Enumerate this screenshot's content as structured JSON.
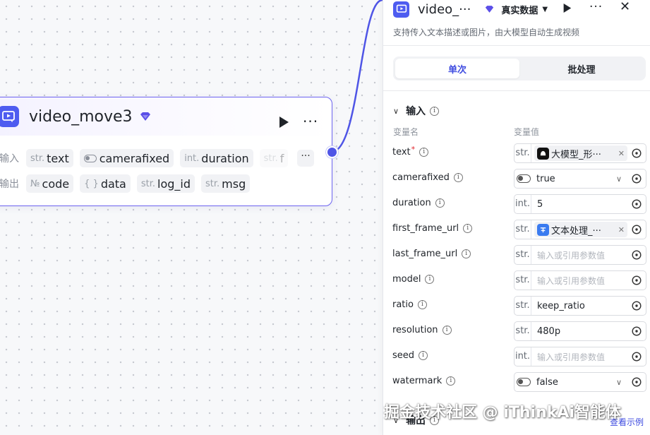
{
  "node": {
    "title": "video_move3",
    "input_label": "输入",
    "output_label": "输出",
    "inputs": [
      {
        "type": "str.",
        "name": "text"
      },
      {
        "type": "",
        "name": "camerafixed"
      },
      {
        "type": "int.",
        "name": "duration"
      },
      {
        "type": "str.",
        "name": "f"
      }
    ],
    "outputs": [
      {
        "type": "№",
        "name": "code"
      },
      {
        "type": "{ }",
        "name": "data"
      },
      {
        "type": "str.",
        "name": "log_id"
      },
      {
        "type": "str.",
        "name": "msg"
      }
    ],
    "more": "···"
  },
  "panel": {
    "title": "video_···",
    "mode": "真实数据",
    "description": "支持传入文本描述或图片，由大模型自动生成视频",
    "tabs": [
      {
        "label": "单次",
        "active": true
      },
      {
        "label": "批处理",
        "active": false
      }
    ],
    "input_section": "输入",
    "col_name": "变量名",
    "col_value": "变量值",
    "params": [
      {
        "name": "text",
        "required": true,
        "type": "str.",
        "kind": "ref",
        "ref_icon": "model-icon",
        "value": "大模型_形···"
      },
      {
        "name": "camerafixed",
        "required": false,
        "type": "",
        "kind": "toggle",
        "value": "true"
      },
      {
        "name": "duration",
        "required": false,
        "type": "int.",
        "kind": "value",
        "value": "5"
      },
      {
        "name": "first_frame_url",
        "required": false,
        "type": "str.",
        "kind": "ref",
        "ref_icon": "text-process-icon",
        "value": "文本处理_···"
      },
      {
        "name": "last_frame_url",
        "required": false,
        "type": "str.",
        "kind": "placeholder",
        "value": "输入或引用参数值"
      },
      {
        "name": "model",
        "required": false,
        "type": "str.",
        "kind": "placeholder",
        "value": "输入或引用参数值"
      },
      {
        "name": "ratio",
        "required": false,
        "type": "str.",
        "kind": "value",
        "value": "keep_ratio"
      },
      {
        "name": "resolution",
        "required": false,
        "type": "str.",
        "kind": "value",
        "value": "480p"
      },
      {
        "name": "seed",
        "required": false,
        "type": "int.",
        "kind": "placeholder",
        "value": "输入或引用参数值"
      },
      {
        "name": "watermark",
        "required": false,
        "type": "",
        "kind": "toggle",
        "value": "false"
      }
    ],
    "output_section": "输出",
    "example_link": "查看示例"
  },
  "watermark": "掘金技术社区 @ iThinkAi智能体",
  "colors": {
    "accent": "#4e5cf0",
    "port": "#4f55e6",
    "edge": "#4f55e6"
  }
}
